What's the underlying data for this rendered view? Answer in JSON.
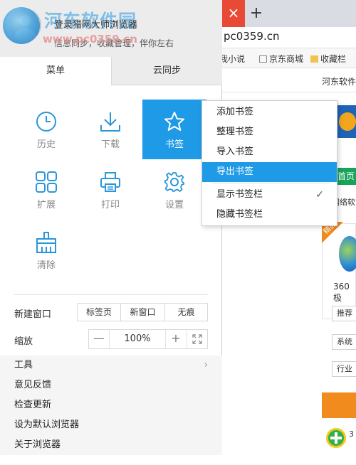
{
  "browser": {
    "url": "pc0359.cn",
    "tab_close": "×",
    "new_tab": "+",
    "bookmarks_bar": [
      "我小说",
      "京东商城",
      "收藏栏"
    ],
    "sub_bar_text": "河东软件",
    "page": {
      "home": "首页",
      "nav": "网络软",
      "badge": "精品",
      "product": "360极",
      "chips": [
        "推荐",
        "系统",
        "行业"
      ],
      "side_text": "3"
    }
  },
  "watermark": {
    "title": "河东软件园",
    "url": "www.pc0359.cn"
  },
  "menu": {
    "header": {
      "login_text": "登录猎网大师浏览器",
      "sub_text": "信息同步，收藏管理，伴你左右"
    },
    "tabs": [
      {
        "label": "菜单",
        "active": true
      },
      {
        "label": "云同步",
        "active": false
      }
    ],
    "grid": [
      {
        "label": "历史",
        "icon": "clock-icon"
      },
      {
        "label": "下载",
        "icon": "download-icon"
      },
      {
        "label": "书签",
        "icon": "star-icon",
        "active": true
      },
      {
        "label": "扩展",
        "icon": "extensions-icon"
      },
      {
        "label": "打印",
        "icon": "printer-icon"
      },
      {
        "label": "设置",
        "icon": "gear-icon"
      },
      {
        "label": "清除",
        "icon": "broom-icon"
      }
    ],
    "new_window": {
      "label": "新建窗口",
      "options": [
        "标签页",
        "新窗口",
        "无痕"
      ]
    },
    "zoom": {
      "label": "缩放",
      "minus": "—",
      "value": "100%",
      "plus": "+",
      "fullscreen_icon": "fullscreen-icon"
    },
    "list": [
      {
        "label": "工具",
        "has_submenu": true,
        "chevron": "›"
      },
      {
        "label": "意见反馈"
      },
      {
        "label": "检查更新"
      },
      {
        "label": "设为默认浏览器"
      },
      {
        "label": "关于浏览器"
      }
    ]
  },
  "bookmark_submenu": {
    "items": [
      {
        "label": "添加书签"
      },
      {
        "label": "整理书签"
      },
      {
        "label": "导入书签"
      },
      {
        "label": "导出书签",
        "highlighted": true
      },
      {
        "label": "显示书签栏",
        "checked": true,
        "check": "✓"
      },
      {
        "label": "隐藏书签栏"
      }
    ]
  },
  "colors": {
    "accent": "#1f9ae6",
    "tab_close": "#e84a35",
    "icon_blue": "#2b96d9"
  }
}
